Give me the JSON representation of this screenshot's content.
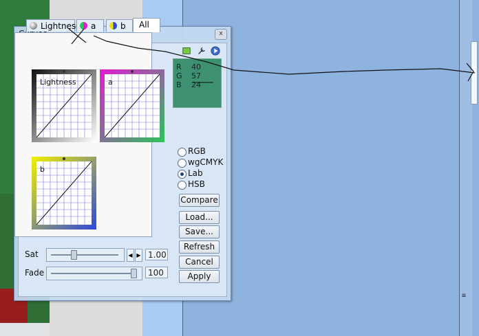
{
  "dialog": {
    "title": "Curves",
    "close_label": "x"
  },
  "tabs": [
    {
      "label": "Lightness",
      "icon": "lightness-icon",
      "active": false
    },
    {
      "label": "a",
      "icon": "a-channel-icon",
      "active": false
    },
    {
      "label": "b",
      "icon": "b-channel-icon",
      "active": false
    },
    {
      "label": "All",
      "active": true
    }
  ],
  "curves": [
    {
      "label": "Lightness",
      "border_color": "#444444"
    },
    {
      "label": "a",
      "border_color": "#e21ad6"
    },
    {
      "label": "b",
      "border_color": "#f2f000"
    }
  ],
  "color_readout": {
    "r_label": "R",
    "r_value": "40",
    "g_label": "G",
    "g_value": "57",
    "b_label": "B",
    "b_value": "24",
    "swatch_color": "#3d9070"
  },
  "color_modes": [
    {
      "label": "RGB",
      "selected": false
    },
    {
      "label": "wgCMYK",
      "selected": false
    },
    {
      "label": "Lab",
      "selected": true
    },
    {
      "label": "HSB",
      "selected": false
    }
  ],
  "buttons": {
    "compare": "Compare",
    "load": "Load...",
    "save": "Save...",
    "refresh": "Refresh",
    "cancel": "Cancel",
    "apply": "Apply"
  },
  "sat": {
    "label": "Sat",
    "value": "1.00"
  },
  "fade": {
    "label": "Fade",
    "value": "100"
  },
  "toolbar": [
    "eyedropper-icon",
    "settings-icon",
    "play-icon"
  ]
}
